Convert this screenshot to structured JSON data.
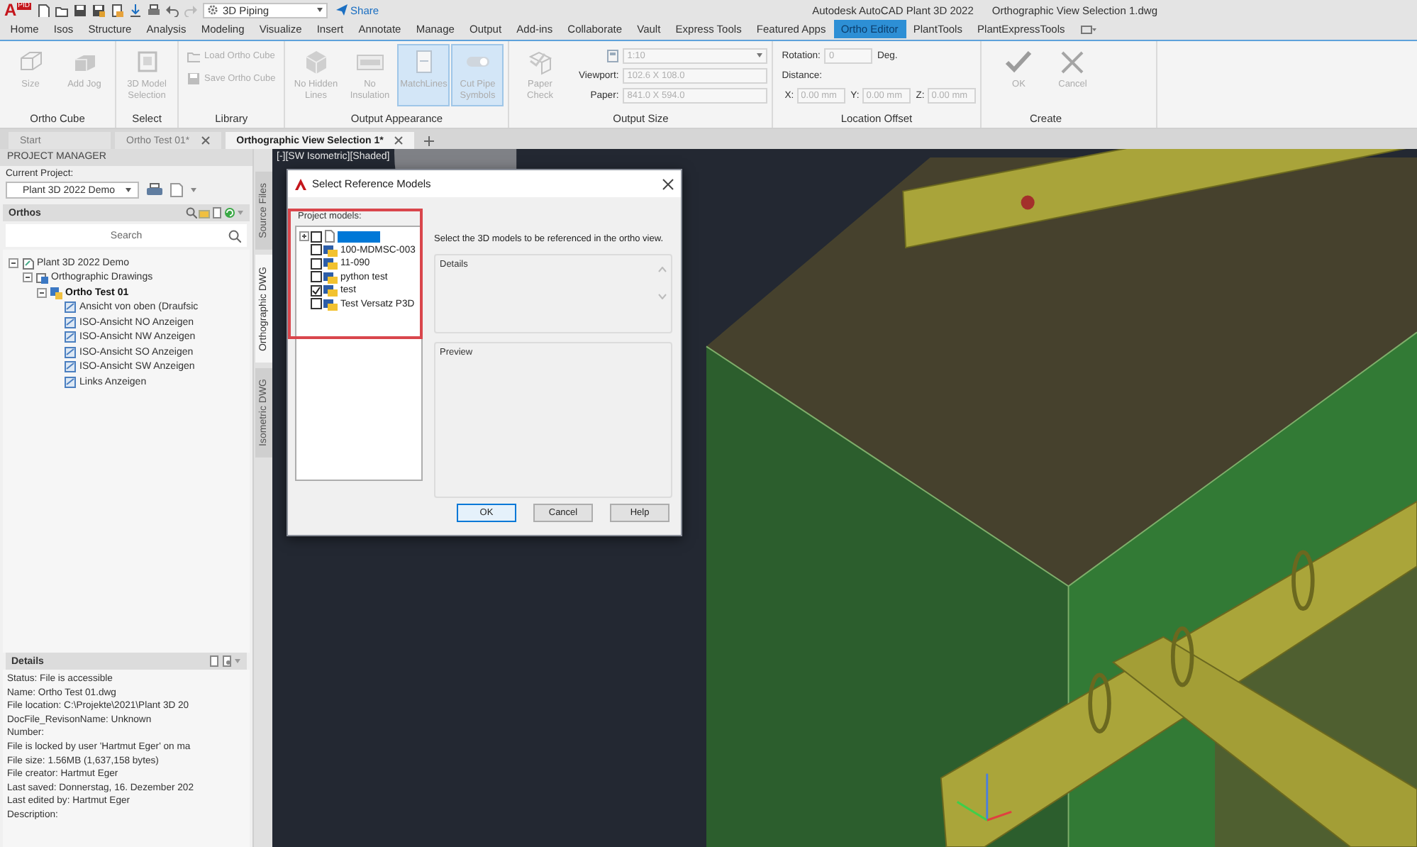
{
  "title_bar": {
    "logo": "A",
    "logo_badge": "PID",
    "workspace": "3D Piping",
    "share": "Share",
    "app_title": "Autodesk AutoCAD Plant 3D 2022",
    "file_title": "Orthographic View Selection 1.dwg"
  },
  "ribbon_tabs": [
    {
      "label": "Home",
      "selected": false
    },
    {
      "label": "Isos",
      "selected": false
    },
    {
      "label": "Structure",
      "selected": false
    },
    {
      "label": "Analysis",
      "selected": false
    },
    {
      "label": "Modeling",
      "selected": false
    },
    {
      "label": "Visualize",
      "selected": false
    },
    {
      "label": "Insert",
      "selected": false
    },
    {
      "label": "Annotate",
      "selected": false
    },
    {
      "label": "Manage",
      "selected": false
    },
    {
      "label": "Output",
      "selected": false
    },
    {
      "label": "Add-ins",
      "selected": false
    },
    {
      "label": "Collaborate",
      "selected": false
    },
    {
      "label": "Vault",
      "selected": false
    },
    {
      "label": "Express Tools",
      "selected": false
    },
    {
      "label": "Featured Apps",
      "selected": false
    },
    {
      "label": "Ortho Editor",
      "selected": true
    },
    {
      "label": "PlantTools",
      "selected": false
    },
    {
      "label": "PlantExpressTools",
      "selected": false
    }
  ],
  "ribbon_panels": [
    {
      "kind": "buttons",
      "title": "Ortho Cube",
      "items": [
        {
          "kind": "large",
          "label": "Size",
          "disabled": true,
          "selected": false
        },
        {
          "kind": "large",
          "label": "Add Jog",
          "disabled": true,
          "selected": false
        }
      ]
    },
    {
      "kind": "buttons",
      "title": "Select",
      "items": [
        {
          "kind": "large",
          "label": "3D Model Selection",
          "disabled": true,
          "selected": false
        }
      ]
    },
    {
      "kind": "buttons",
      "title": "Library",
      "items": [
        {
          "kind": "small",
          "label": "Load Ortho Cube",
          "disabled": true,
          "selected": false
        },
        {
          "kind": "small",
          "label": "Save Ortho Cube",
          "disabled": true,
          "selected": false
        }
      ]
    },
    {
      "kind": "buttons",
      "title": "Output Appearance",
      "items": [
        {
          "kind": "large",
          "label": "No Hidden Lines",
          "disabled": true,
          "selected": false
        },
        {
          "kind": "large",
          "label": "No Insulation",
          "disabled": true,
          "selected": false
        },
        {
          "kind": "large",
          "label": "MatchLines",
          "disabled": true,
          "selected": true
        },
        {
          "kind": "large",
          "label": "Cut Pipe Symbols",
          "disabled": true,
          "selected": true
        }
      ]
    },
    {
      "kind": "size",
      "title": "Output Size",
      "button": {
        "label": "Paper Check",
        "disabled": true,
        "selected": false
      },
      "scale": "1:10",
      "fields": [
        {
          "label": "Viewport:",
          "value": "102.6 X 108.0"
        },
        {
          "label": "Paper:",
          "value": "841.0 X 594.0"
        }
      ]
    },
    {
      "kind": "offset",
      "title": "Location Offset",
      "rotation": {
        "label": "Rotation:",
        "value": "0",
        "unit": "Deg."
      },
      "distance_label": "Distance:",
      "coords": [
        {
          "label": "X:",
          "value": "0.00 mm"
        },
        {
          "label": "Y:",
          "value": "0.00 mm"
        },
        {
          "label": "Z:",
          "value": "0.00 mm"
        }
      ]
    },
    {
      "kind": "buttons",
      "title": "Create",
      "items": [
        {
          "kind": "large",
          "label": "OK",
          "disabled": true,
          "selected": false
        },
        {
          "kind": "large",
          "label": "Cancel",
          "disabled": true,
          "selected": false
        }
      ]
    }
  ],
  "doc_tabs": [
    {
      "label": "Start",
      "selected": false,
      "closable": false
    },
    {
      "label": "Ortho Test 01*",
      "selected": false,
      "closable": true
    },
    {
      "label": "Orthographic View Selection 1*",
      "selected": true,
      "closable": true
    }
  ],
  "project_manager": {
    "title": "PROJECT MANAGER",
    "current_project_label": "Current Project:",
    "current_project": "Plant 3D 2022 Demo",
    "section_title": "Orthos",
    "search_placeholder": "Search",
    "tree": [
      {
        "label": "Plant 3D 2022 Demo",
        "current": false,
        "expanded": true,
        "children": [
          {
            "label": "Orthographic Drawings",
            "current": false,
            "expanded": true,
            "children": [
              {
                "label": "Ortho Test 01",
                "current": true,
                "expanded": true,
                "children": [
                  {
                    "label": "Ansicht von oben (Draufsic",
                    "current": false
                  },
                  {
                    "label": "ISO-Ansicht NO Anzeigen",
                    "current": false
                  },
                  {
                    "label": "ISO-Ansicht NW Anzeigen",
                    "current": false
                  },
                  {
                    "label": "ISO-Ansicht SO Anzeigen",
                    "current": false
                  },
                  {
                    "label": "ISO-Ansicht SW Anzeigen",
                    "current": false
                  },
                  {
                    "label": "Links Anzeigen",
                    "current": false
                  }
                ]
              }
            ]
          }
        ]
      }
    ],
    "details_title": "Details",
    "details": [
      "Status: File is accessible",
      "Name: Ortho Test 01.dwg",
      "File location: C:\\Projekte\\2021\\Plant 3D 20",
      "DocFile_RevisonName:  Unknown",
      "Number:",
      "File is locked by user 'Hartmut Eger' on ma",
      "File size: 1.56MB (1,637,158 bytes)",
      "File creator: Hartmut Eger",
      "Last saved: Donnerstag, 16. Dezember 202",
      "Last edited by: Hartmut Eger",
      "Description:"
    ]
  },
  "side_tabs": [
    {
      "label": "Source Files",
      "selected": false
    },
    {
      "label": "Orthographic DWG",
      "selected": true
    },
    {
      "label": "Isometric DWG",
      "selected": false
    }
  ],
  "viewport": {
    "label": "[-][SW Isometric][Shaded]"
  },
  "dialog": {
    "title": "Select Reference Models",
    "group_label": "Project models:",
    "models": [
      {
        "kind": "file",
        "expandable": true,
        "expanded": false,
        "checked": false,
        "selected": true
      },
      {
        "kind": "model",
        "label": "100-MDMSC-003",
        "checked": false,
        "selected": false
      },
      {
        "kind": "model",
        "label": "11-090",
        "checked": false,
        "selected": false
      },
      {
        "kind": "model",
        "label": "python test",
        "checked": false,
        "selected": false
      },
      {
        "kind": "model",
        "label": "test",
        "checked": true,
        "selected": false
      },
      {
        "kind": "model",
        "label": "Test Versatz P3D",
        "checked": false,
        "selected": false
      }
    ],
    "instruction": "Select the 3D models to be referenced in the ortho view.",
    "details_label": "Details",
    "preview_label": "Preview",
    "buttons": [
      {
        "label": "OK",
        "default": true
      },
      {
        "label": "Cancel",
        "default": false
      },
      {
        "label": "Help",
        "default": false
      }
    ]
  }
}
